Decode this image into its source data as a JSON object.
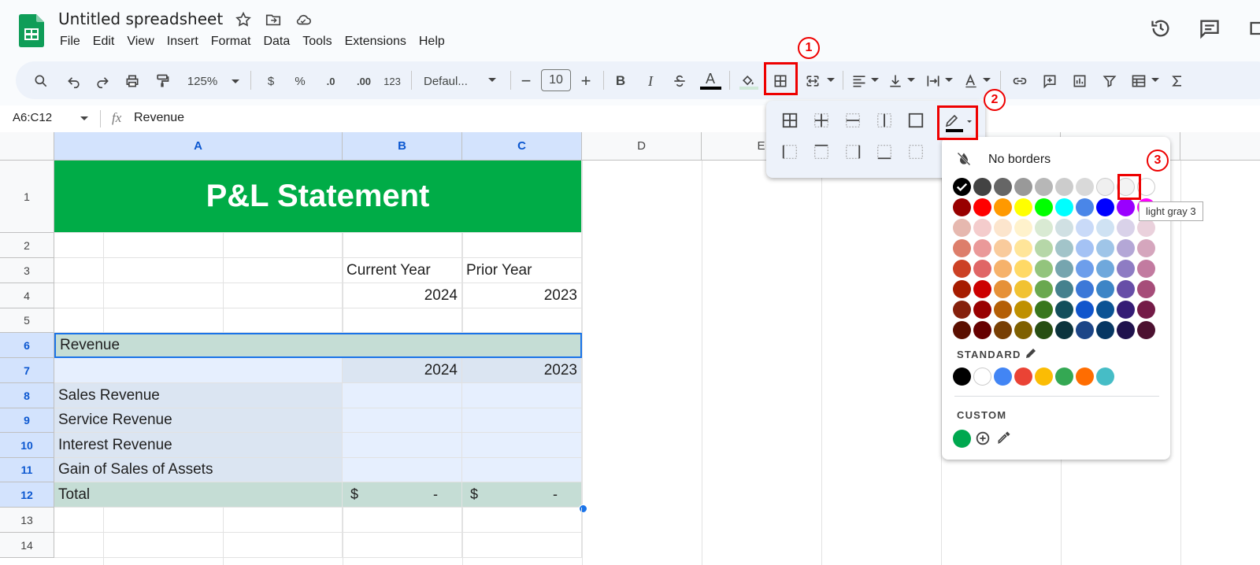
{
  "app": {
    "title": "Untitled spreadsheet"
  },
  "menu": [
    "File",
    "Edit",
    "View",
    "Insert",
    "Format",
    "Data",
    "Tools",
    "Extensions",
    "Help"
  ],
  "toolbar": {
    "zoom": "125%",
    "font": "Defaul...",
    "font_size": "10",
    "dollar": "$",
    "percent": "%",
    "dec_less": ".0",
    "dec_more": ".00",
    "num_fmt": "123",
    "bold": "B",
    "italic": "I",
    "text_color_glyph": "A"
  },
  "formula_bar": {
    "name_box": "A6:C12",
    "fx": "fx",
    "value": "Revenue"
  },
  "columns": [
    "A",
    "B",
    "C",
    "D",
    "E"
  ],
  "rows": [
    "1",
    "2",
    "3",
    "4",
    "5",
    "6",
    "7",
    "8",
    "9",
    "10",
    "11",
    "12",
    "13",
    "14"
  ],
  "sheet": {
    "title": "P&L Statement",
    "b3": "Current Year",
    "c3": "Prior Year",
    "b4": "2024",
    "c4": "2023",
    "a6": "Revenue",
    "b7": "2024",
    "c7": "2023",
    "a8": "Sales Revenue",
    "a9": "Service Revenue",
    "a10": "Interest Revenue",
    "a11": "Gain of Sales of Assets",
    "a12": "Total",
    "b12_sym": "$",
    "b12_val": "-",
    "c12_sym": "$",
    "c12_val": "-"
  },
  "border_popup": {
    "no_borders": "No borders",
    "standard": "STANDARD",
    "custom": "CUSTOM",
    "tooltip": "light gray 3"
  },
  "palette_rows": [
    [
      "#000000",
      "#434343",
      "#666666",
      "#999999",
      "#b7b7b7",
      "#cccccc",
      "#d9d9d9",
      "#efefef",
      "#f3f3f3",
      "#ffffff"
    ],
    [
      "#980000",
      "#ff0000",
      "#ff9900",
      "#ffff00",
      "#00ff00",
      "#00ffff",
      "#4a86e8",
      "#0000ff",
      "#9900ff",
      "#ff00ff"
    ],
    [
      "#e6b8af",
      "#f4cccc",
      "#fce5cd",
      "#fff2cc",
      "#d9ead3",
      "#d0e0e3",
      "#c9daf8",
      "#cfe2f3",
      "#d9d2e9",
      "#ead1dc"
    ],
    [
      "#dd7e6b",
      "#ea9999",
      "#f9cb9c",
      "#ffe599",
      "#b6d7a8",
      "#a2c4c9",
      "#a4c2f4",
      "#9fc5e8",
      "#b4a7d6",
      "#d5a6bd"
    ],
    [
      "#cc4125",
      "#e06666",
      "#f6b26b",
      "#ffd966",
      "#93c47d",
      "#76a5af",
      "#6d9eeb",
      "#6fa8dc",
      "#8e7cc3",
      "#c27ba0"
    ],
    [
      "#a61c00",
      "#cc0000",
      "#e69138",
      "#f1c232",
      "#6aa84f",
      "#45818e",
      "#3c78d8",
      "#3d85c6",
      "#674ea7",
      "#a64d79"
    ],
    [
      "#85200c",
      "#990000",
      "#b45f06",
      "#bf9000",
      "#38761d",
      "#134f5c",
      "#1155cc",
      "#0b5394",
      "#351c75",
      "#741b47"
    ],
    [
      "#5b0f00",
      "#660000",
      "#783f04",
      "#7f6000",
      "#274e13",
      "#0c343d",
      "#1c4587",
      "#073763",
      "#20124d",
      "#4c1130"
    ]
  ],
  "standard_colors": [
    "#000000",
    "#ffffff",
    "#4285f4",
    "#ea4335",
    "#fbbc04",
    "#34a853",
    "#ff6d01",
    "#46bdc6"
  ],
  "custom_colors": [
    "#00a84f"
  ],
  "annotations": [
    "1",
    "2",
    "3"
  ]
}
